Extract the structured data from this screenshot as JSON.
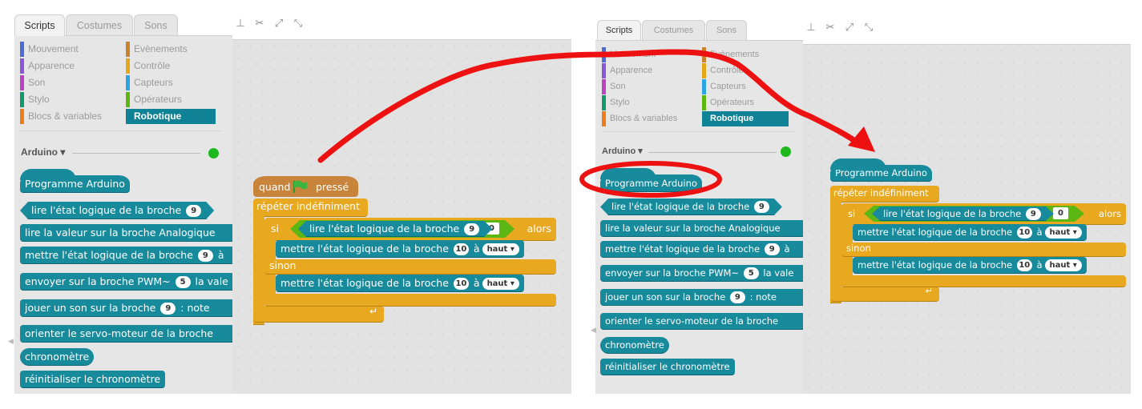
{
  "panels": [
    {
      "tabs": [
        "Scripts",
        "Costumes",
        "Sons"
      ],
      "active_tab": 0,
      "tools": [
        "stamp-icon",
        "cut-icon",
        "grow-icon",
        "shrink-icon"
      ],
      "categories": {
        "left": [
          {
            "label": "Mouvement",
            "color": "#4a6cd4"
          },
          {
            "label": "Apparence",
            "color": "#8a55d7"
          },
          {
            "label": "Son",
            "color": "#bb42c3"
          },
          {
            "label": "Stylo",
            "color": "#0e9a6c"
          },
          {
            "label": "Blocs & variables",
            "color": "#ee7d16"
          }
        ],
        "right": [
          {
            "label": "Evènements",
            "color": "#c88330"
          },
          {
            "label": "Contrôle",
            "color": "#e1a91a"
          },
          {
            "label": "Capteurs",
            "color": "#2ca5e2"
          },
          {
            "label": "Opérateurs",
            "color": "#5cb712"
          },
          {
            "label": "Robotique",
            "color": "#0f8295",
            "selected": true
          }
        ]
      },
      "extension": {
        "title": "Arduino ▾",
        "status_color": "#1cb81c"
      },
      "palette_blocks": [
        {
          "label": "Programme Arduino",
          "type": "hat"
        },
        {
          "label": "lire l'état logique de la broche",
          "arg": "9",
          "type": "bool"
        },
        {
          "label": "lire la valeur sur la broche Analogique",
          "type": "reporter",
          "clipped": true
        },
        {
          "label": "mettre l'état logique de la broche",
          "arg": "9",
          "suffix": "à",
          "type": "command",
          "clipped": true
        },
        {
          "label": "envoyer sur la broche PWM~",
          "arg": "5",
          "suffix": "la vale",
          "type": "command",
          "clipped": true
        },
        {
          "label": "jouer un son sur la broche",
          "arg": "9",
          "suffix": ": note",
          "type": "command",
          "clipped": true
        },
        {
          "label": "orienter le servo-moteur de la broche",
          "type": "command",
          "clipped": true
        },
        {
          "label": "chronomètre",
          "type": "reporter"
        },
        {
          "label": "réinitialiser le chronomètre",
          "type": "command"
        }
      ],
      "script": {
        "hat_label": "quand",
        "hat_icon": "green-flag-icon",
        "hat_suffix": "pressé",
        "forever_label": "répéter indéfiniment",
        "if_label": "si",
        "condition_block": "lire l'état logique de la broche",
        "condition_pin": "9",
        "equals": "=",
        "condition_value": "0",
        "then_label": "alors",
        "then_block": "mettre l'état logique de la broche",
        "then_pin": "10",
        "then_mid": "à",
        "then_value": "haut",
        "else_label": "sinon",
        "else_block": "mettre l'état logique de la broche",
        "else_pin": "10",
        "else_mid": "à",
        "else_value": "haut"
      }
    },
    {
      "tabs": [
        "Scripts",
        "Costumes",
        "Sons"
      ],
      "active_tab": 0,
      "tools": [
        "stamp-icon",
        "cut-icon",
        "grow-icon",
        "shrink-icon"
      ],
      "categories": {
        "left": [
          {
            "label": "Mouvement",
            "color": "#4a6cd4"
          },
          {
            "label": "Apparence",
            "color": "#8a55d7"
          },
          {
            "label": "Son",
            "color": "#bb42c3"
          },
          {
            "label": "Stylo",
            "color": "#0e9a6c"
          },
          {
            "label": "Blocs & variables",
            "color": "#ee7d16"
          }
        ],
        "right": [
          {
            "label": "Evènements",
            "color": "#c88330"
          },
          {
            "label": "Contrôle",
            "color": "#e1a91a"
          },
          {
            "label": "Capteurs",
            "color": "#2ca5e2"
          },
          {
            "label": "Opérateurs",
            "color": "#5cb712"
          },
          {
            "label": "Robotique",
            "color": "#0f8295",
            "selected": true
          }
        ]
      },
      "extension": {
        "title": "Arduino ▾",
        "status_color": "#1cb81c"
      },
      "palette_blocks": [
        {
          "label": "Programme Arduino",
          "type": "hat"
        },
        {
          "label": "lire l'état logique de la broche",
          "arg": "9",
          "type": "bool"
        },
        {
          "label": "lire la valeur sur la broche Analogique",
          "type": "reporter",
          "clipped": true
        },
        {
          "label": "mettre l'état logique de la broche",
          "arg": "9",
          "suffix": "à",
          "type": "command",
          "clipped": true
        },
        {
          "label": "envoyer sur la broche PWM~",
          "arg": "5",
          "suffix": "la vale",
          "type": "command",
          "clipped": true
        },
        {
          "label": "jouer un son sur la broche",
          "arg": "9",
          "suffix": ": note",
          "type": "command",
          "clipped": true
        },
        {
          "label": "orienter le servo-moteur de la broche",
          "type": "command",
          "clipped": true
        },
        {
          "label": "chronomètre",
          "type": "reporter"
        },
        {
          "label": "réinitialiser le chronomètre",
          "type": "command"
        }
      ],
      "script": {
        "hat_label": "Programme Arduino",
        "forever_label": "répéter indéfiniment",
        "if_label": "si",
        "condition_block": "lire l'état logique de la broche",
        "condition_pin": "9",
        "equals": "=",
        "condition_value": "0",
        "then_label": "alors",
        "then_block": "mettre l'état logique de la broche",
        "then_pin": "10",
        "then_mid": "à",
        "then_value": "haut",
        "else_label": "sinon",
        "else_block": "mettre l'état logique de la broche",
        "else_pin": "10",
        "else_mid": "à",
        "else_value": "haut"
      }
    }
  ],
  "annotations": {
    "arrow_color": "#ee1111",
    "arrow_meaning": "replace 'quand drapeau pressé' with 'Programme Arduino'",
    "circled_block": "Programme Arduino"
  }
}
